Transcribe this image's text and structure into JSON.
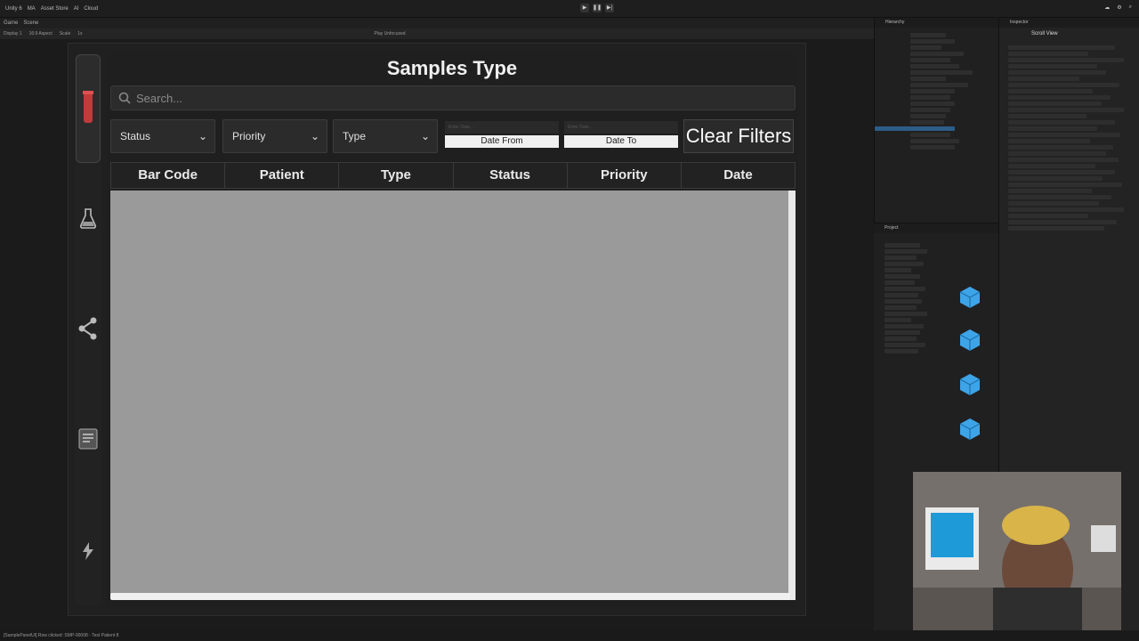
{
  "editor": {
    "menu": [
      "Unity 6",
      "MA",
      "Asset Store",
      "AI",
      "Cloud"
    ],
    "tabs": [
      "Game",
      "Scene"
    ],
    "game_toolbar": {
      "display": "Display 1",
      "aspect": "16:9 Aspect",
      "scale_label": "Scale",
      "scale_value": "1x",
      "play_mode": "Play Unfocused"
    },
    "status_bar": "[SamplePanelUI] Row clicked: SMP-00008 - Test Patient 8",
    "hierarchy_title": "Hierarchy",
    "project_title": "Project",
    "inspector_title": "Inspector",
    "inspector_object": "Scroll View"
  },
  "app": {
    "title": "Samples Type",
    "search_placeholder": "Search...",
    "filters": {
      "status": "Status",
      "priority": "Priority",
      "type": "Type",
      "date_from": "Date From",
      "date_to": "Date To",
      "date_placeholder": "Enter Date...",
      "clear": "Clear Filters"
    },
    "columns": [
      "Bar Code",
      "Patient",
      "Type",
      "Status",
      "Priority",
      "Date"
    ]
  },
  "colors": {
    "accent": "#d64545",
    "table_body": "#9a9a9a",
    "header_bg": "#222222"
  }
}
